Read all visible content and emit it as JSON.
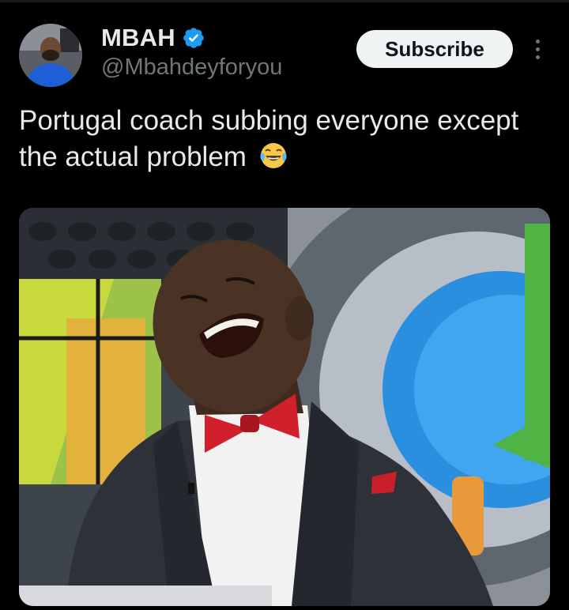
{
  "user": {
    "display_name": "MBAH",
    "handle": "@Mbahdeyforyou",
    "verified": true,
    "verified_color": "#1d9bf0"
  },
  "actions": {
    "subscribe_label": "Subscribe",
    "more_icon": "more-vertical-icon"
  },
  "tweet": {
    "text": "Portugal coach subbing everyone except the actual problem",
    "emoji": "😂"
  },
  "media": {
    "type": "photo"
  },
  "colors": {
    "background": "#000000",
    "text_primary": "#e7e9ea",
    "text_secondary": "#71767b",
    "button_bg": "#eff3f4",
    "button_text": "#0f1419"
  }
}
